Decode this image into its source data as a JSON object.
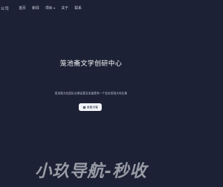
{
  "header": {
    "brand_fragment": "公司",
    "nav": [
      {
        "label": "首页"
      },
      {
        "label": "新闻"
      },
      {
        "label": "项目"
      },
      {
        "label": "关于"
      },
      {
        "label": "联系"
      }
    ]
  },
  "hero": {
    "title": "笼池斋文学创研中心",
    "subtitle": "笼池斋文化团队长期运营及发展提供一个坚实而强大的后盾",
    "button_label": "查看详情"
  },
  "watermark": {
    "text": "小玖导航-秒收"
  },
  "colors": {
    "background": "#1c2135",
    "button_bg": "#f3f4f8",
    "text": "#ffffff"
  },
  "icons": {
    "button_icon": "book-icon",
    "dropdown_icon": "chevron-down-icon"
  }
}
